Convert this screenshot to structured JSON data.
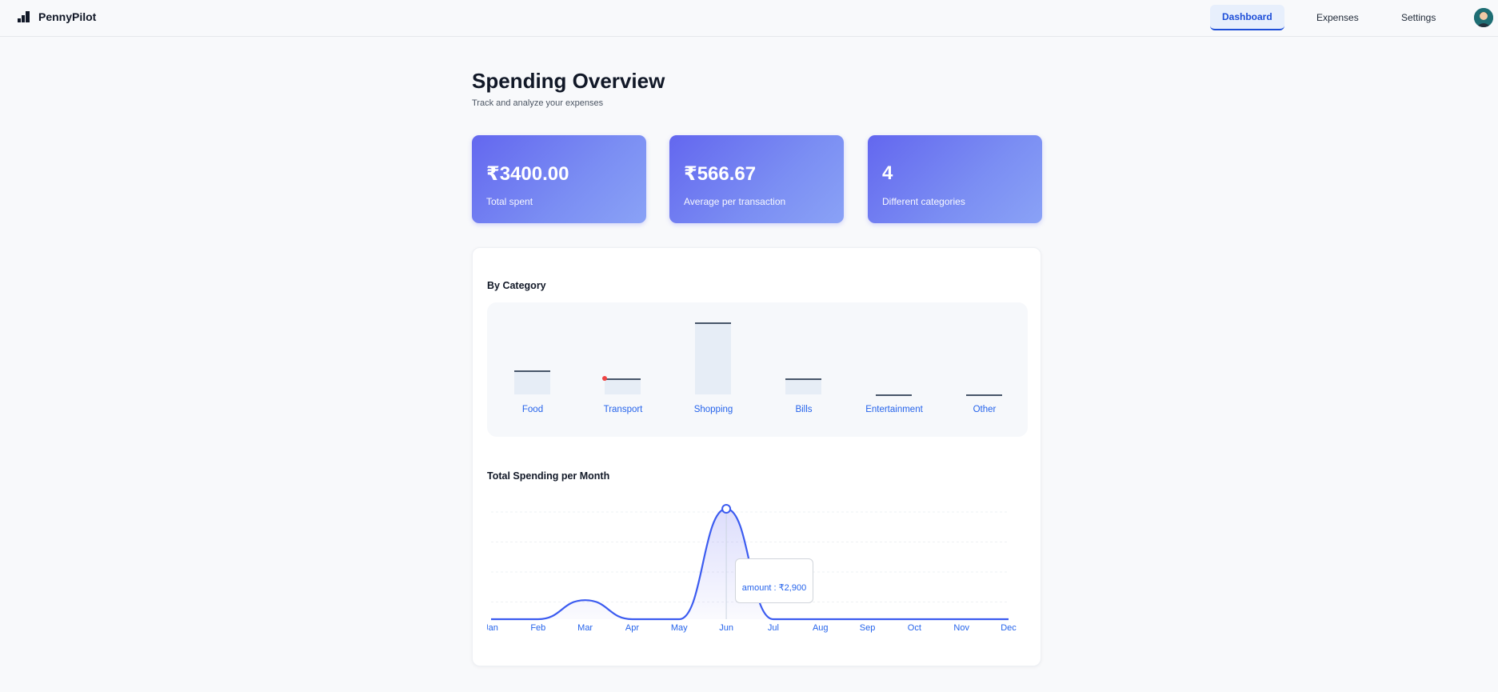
{
  "app": {
    "name": "PennyPilot"
  },
  "nav": {
    "dashboard": "Dashboard",
    "expenses": "Expenses",
    "settings": "Settings"
  },
  "page": {
    "title": "Spending Overview",
    "subtitle": "Track and analyze your expenses"
  },
  "stats": [
    {
      "value": "₹3400.00",
      "label": "Total spent"
    },
    {
      "value": "₹566.67",
      "label": "Average per transaction"
    },
    {
      "value": "4",
      "label": "Different categories"
    }
  ],
  "colors": {
    "accent": "#2563eb",
    "card_gradient_start": "#6367ef",
    "card_gradient_end": "#8aa2f6",
    "line": "#3b5bf0"
  },
  "chart_data": [
    {
      "type": "bar",
      "title": "By Category",
      "categories": [
        "Food",
        "Transport",
        "Shopping",
        "Bills",
        "Entertainment",
        "Other"
      ],
      "values": [
        300,
        200,
        900,
        200,
        0,
        0
      ],
      "highlighted_category": "Transport"
    },
    {
      "type": "area",
      "title": "Total Spending per Month",
      "x": [
        "Jan",
        "Feb",
        "Mar",
        "Apr",
        "May",
        "Jun",
        "Jul",
        "Aug",
        "Sep",
        "Oct",
        "Nov",
        "Dec"
      ],
      "values": [
        0,
        0,
        500,
        0,
        0,
        2900,
        0,
        0,
        0,
        0,
        0,
        0
      ],
      "tooltip": {
        "month": "Jun",
        "text": "amount : ₹2,900"
      },
      "grid": true
    }
  ]
}
